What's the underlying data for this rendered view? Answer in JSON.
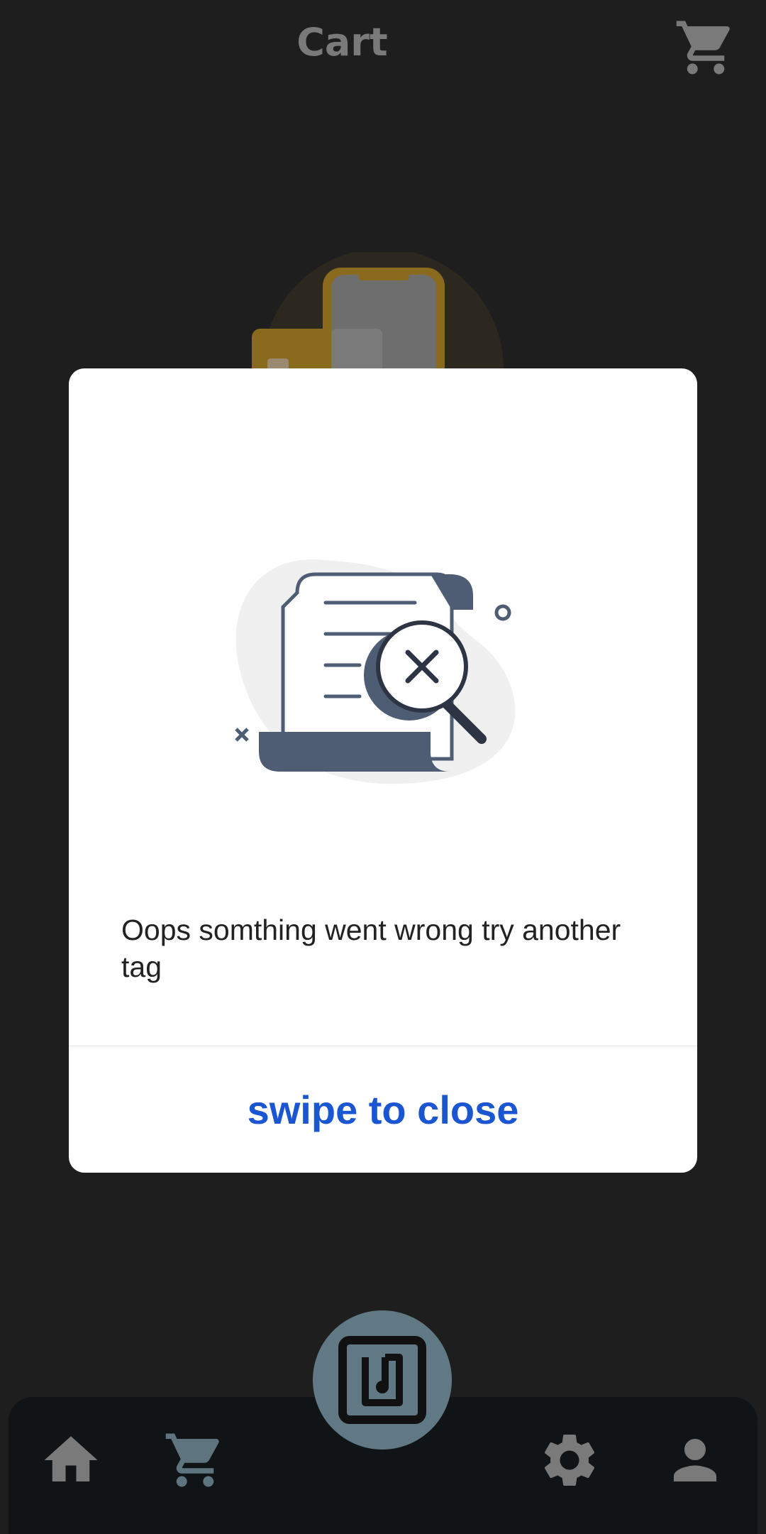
{
  "appbar": {
    "title": "Cart",
    "cart_icon": "shopping-cart-icon"
  },
  "hero": {
    "illustration": "phone-and-card-illustration"
  },
  "dialog": {
    "illustration": "document-search-error-illustration",
    "message": "Oops somthing went wrong try another tag",
    "close_label": "swipe to close"
  },
  "bottom_nav": {
    "items": [
      {
        "icon": "home-icon"
      },
      {
        "icon": "shopping-cart-icon"
      },
      {
        "icon": "gear-icon"
      },
      {
        "icon": "person-icon"
      }
    ],
    "fab_icon": "nfc-icon"
  },
  "colors": {
    "background": "#1e1e1e",
    "nav_background": "#111417",
    "fab": "#607984",
    "dim_icon": "#7a7a7a",
    "accent": "#1a55d2",
    "dialog_background": "#ffffff"
  }
}
